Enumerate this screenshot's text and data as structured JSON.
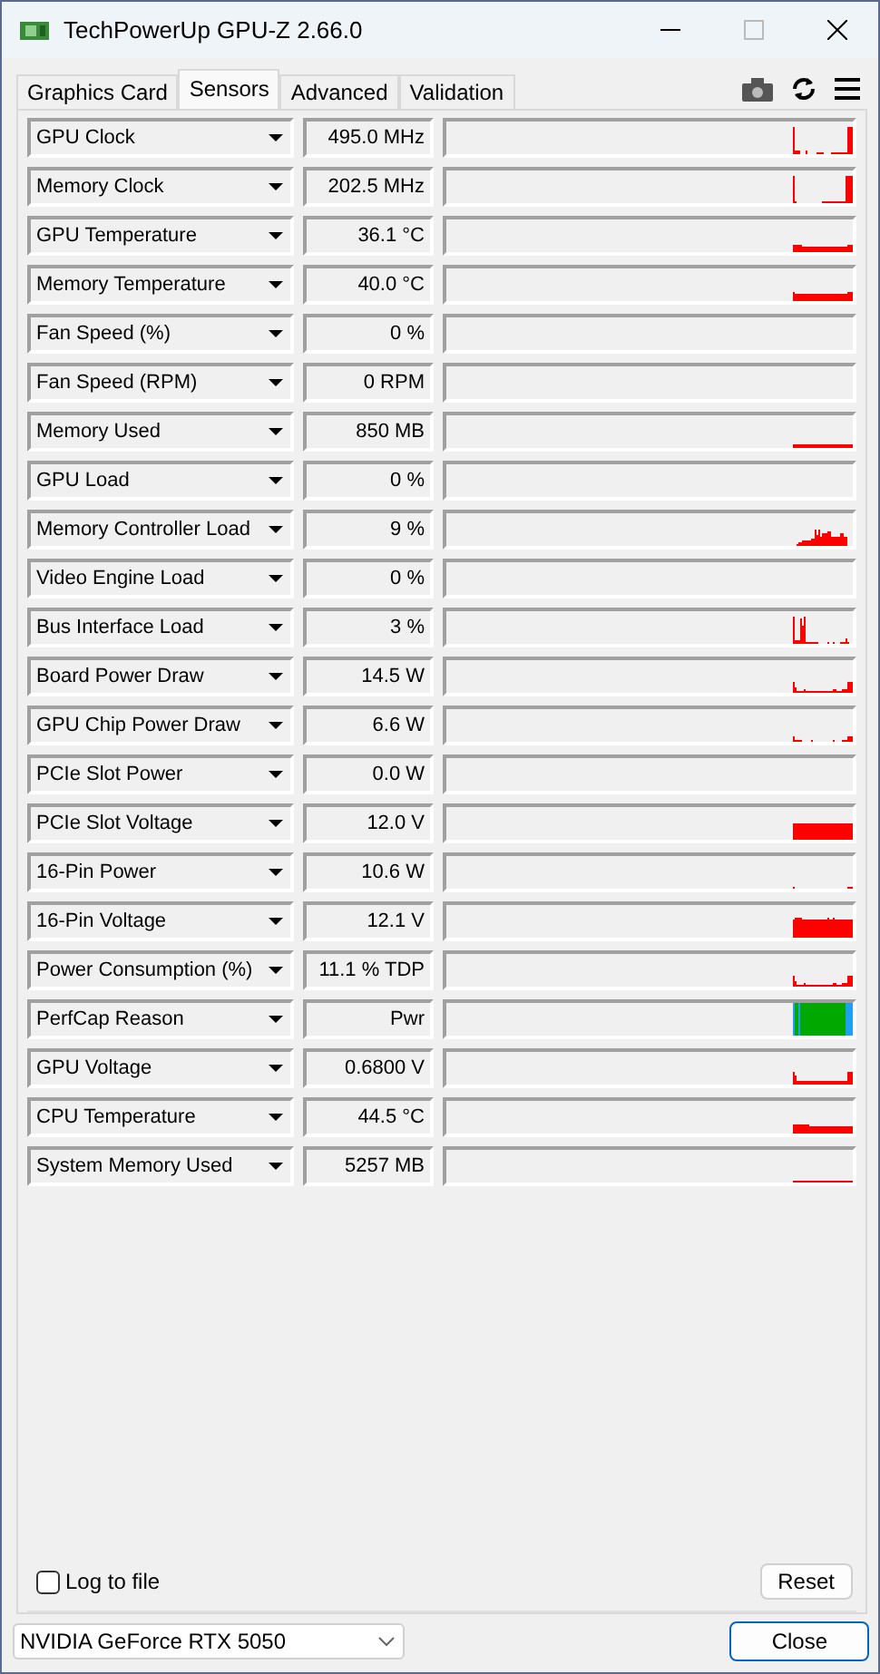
{
  "window": {
    "title": "TechPowerUp GPU-Z 2.66.0"
  },
  "tabs": [
    {
      "label": "Graphics Card",
      "selected": false
    },
    {
      "label": "Sensors",
      "selected": true
    },
    {
      "label": "Advanced",
      "selected": false
    },
    {
      "label": "Validation",
      "selected": false
    }
  ],
  "sensors": [
    {
      "label": "GPU Clock",
      "value": "495.0 MHz"
    },
    {
      "label": "Memory Clock",
      "value": "202.5 MHz"
    },
    {
      "label": "GPU Temperature",
      "value": "36.1 °C"
    },
    {
      "label": "Memory Temperature",
      "value": "40.0 °C"
    },
    {
      "label": "Fan Speed (%)",
      "value": "0 %"
    },
    {
      "label": "Fan Speed (RPM)",
      "value": "0 RPM"
    },
    {
      "label": "Memory Used",
      "value": "850 MB"
    },
    {
      "label": "GPU Load",
      "value": "0 %"
    },
    {
      "label": "Memory Controller Load",
      "value": "9 %"
    },
    {
      "label": "Video Engine Load",
      "value": "0 %"
    },
    {
      "label": "Bus Interface Load",
      "value": "3 %"
    },
    {
      "label": "Board Power Draw",
      "value": "14.5 W"
    },
    {
      "label": "GPU Chip Power Draw",
      "value": "6.6 W"
    },
    {
      "label": "PCIe Slot Power",
      "value": "0.0 W"
    },
    {
      "label": "PCIe Slot Voltage",
      "value": "12.0 V"
    },
    {
      "label": "16-Pin Power",
      "value": "10.6 W"
    },
    {
      "label": "16-Pin Voltage",
      "value": "12.1 V"
    },
    {
      "label": "Power Consumption (%)",
      "value": "11.1 % TDP"
    },
    {
      "label": "PerfCap Reason",
      "value": "Pwr"
    },
    {
      "label": "GPU Voltage",
      "value": "0.6800 V"
    },
    {
      "label": "CPU Temperature",
      "value": "44.5 °C"
    },
    {
      "label": "System Memory Used",
      "value": "5257 MB"
    }
  ],
  "log_to_file": {
    "label": "Log to file",
    "checked": false
  },
  "reset_button": "Reset",
  "device_select": {
    "value": "NVIDIA GeForce RTX 5050"
  },
  "close_button": "Close"
}
